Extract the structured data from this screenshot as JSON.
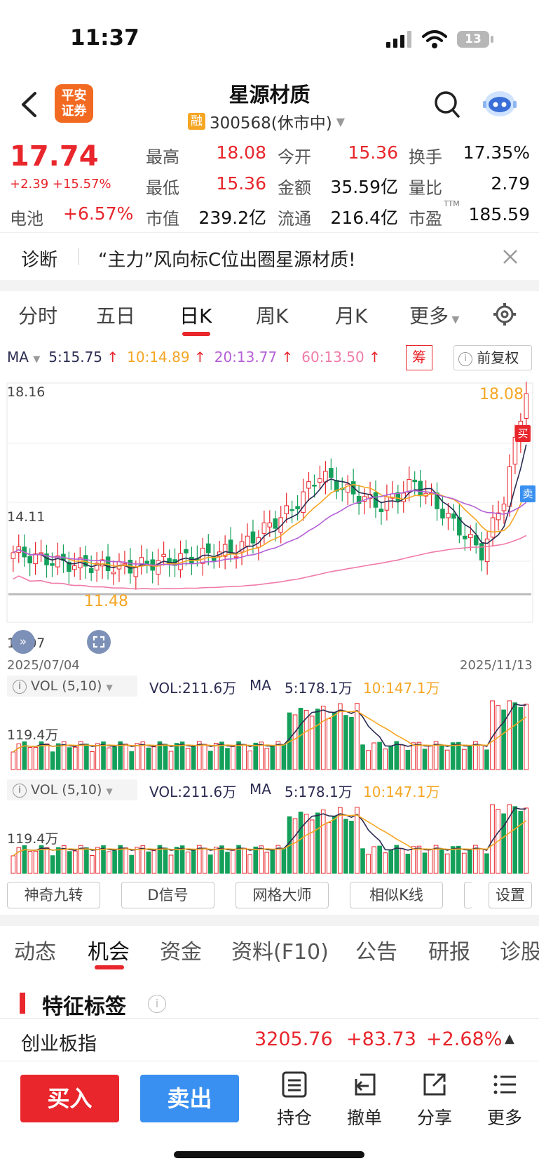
{
  "status": {
    "time": "11:37",
    "battery": "13"
  },
  "header": {
    "logo_text": "平安\n证券",
    "title": "星源材质",
    "rong": "融",
    "code_status": "300568(休市中)"
  },
  "quote": {
    "price": "17.74",
    "change": "+2.39 +15.57%",
    "sector_label": "电池",
    "sector_change": "+6.57%",
    "grid": [
      {
        "label": "最高",
        "value": "18.08",
        "color": "red"
      },
      {
        "label": "今开",
        "value": "15.36",
        "color": "red"
      },
      {
        "label": "换手",
        "value": "17.35%",
        "color": "dark"
      },
      {
        "label": "最低",
        "value": "15.36",
        "color": "red"
      },
      {
        "label": "金额",
        "value": "35.59亿",
        "color": "dark"
      },
      {
        "label": "量比",
        "value": "2.79",
        "color": "dark"
      },
      {
        "label": "市值",
        "value": "239.2亿",
        "color": "dark"
      },
      {
        "label": "流通",
        "value": "216.4亿",
        "color": "dark"
      },
      {
        "label": "市盈",
        "value": "185.59",
        "color": "dark",
        "sup": "TTM"
      }
    ]
  },
  "diagnosis": {
    "label": "诊断",
    "text": "“主力”风向标C位出圈星源材质!"
  },
  "chart_tabs": [
    "分时",
    "五日",
    "日K",
    "周K",
    "月K",
    "更多"
  ],
  "chart_tab_active": 2,
  "ma": {
    "label": "MA",
    "ma5": "5:15.75",
    "ma10": "10:14.89",
    "ma20": "20:13.77",
    "ma60": "60:13.50",
    "chip_label": "筹",
    "adjust_label": "前复权"
  },
  "kline": {
    "y_top": "18.16",
    "y_mid": "14.11",
    "y_bot": "10.07",
    "high_mark": "18.08",
    "low_mark": "11.48",
    "start_date": "2025/07/04",
    "end_date": "2025/11/13",
    "buy_marker": "买",
    "sell_marker": "卖"
  },
  "vol_panels": [
    {
      "title": "VOL (5,10)",
      "vol": "VOL:211.6万",
      "ma_label": "MA",
      "ma5": "5:178.1万",
      "ma10": "10:147.1万",
      "axis": "119.4万"
    },
    {
      "title": "VOL (5,10)",
      "vol": "VOL:211.6万",
      "ma_label": "MA",
      "ma5": "5:178.1万",
      "ma10": "10:147.1万",
      "axis": "119.4万"
    }
  ],
  "tools": [
    "神奇九转",
    "D信号",
    "网格大师",
    "相似K线",
    "设置"
  ],
  "bottom_tabs": [
    "动态",
    "机会",
    "资金",
    "资料(F10)",
    "公告",
    "研报",
    "诊股"
  ],
  "bottom_tab_active": 1,
  "section_title": "特征标签",
  "index_bar": {
    "name": "创业板指",
    "value": "3205.76",
    "change": "+83.73",
    "pct": "+2.68%"
  },
  "actions": {
    "buy": "买入",
    "sell": "卖出",
    "holdings": "持仓",
    "cancel": "撤单",
    "share": "分享",
    "more": "更多"
  },
  "colors": {
    "up": "#e8262c",
    "down": "#14a05a",
    "accent": "#f26a22",
    "sell_btn": "#3a90f0",
    "ma5": "#2b2b52",
    "ma10": "#f5a623",
    "ma20": "#b45fd6",
    "ma60": "#f07aa8"
  }
}
